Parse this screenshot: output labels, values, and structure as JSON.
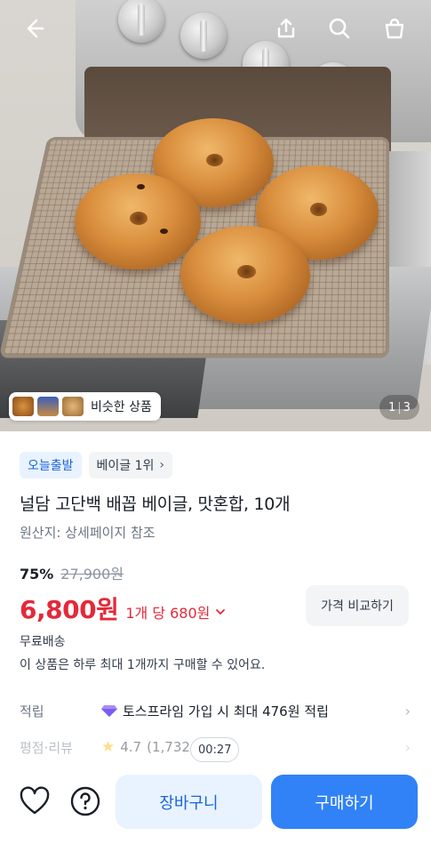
{
  "gallery": {
    "similar_label": "비슷한 상품",
    "current_page": "1",
    "total_pages": "3",
    "separator": "|"
  },
  "badges": {
    "today_delivery": "오늘출발",
    "ranking": "베이글 1위"
  },
  "product": {
    "title": "널담 고단백 배꼽 베이글, 맛혼합, 10개",
    "origin": "원산지: 상세페이지 참조"
  },
  "pricing": {
    "discount": "75%",
    "original_price": "27,900원",
    "price": "6,800원",
    "unit_price": "1개 당 680원",
    "compare_label": "가격 비교하기"
  },
  "shipping": {
    "free_shipping": "무료배송",
    "purchase_limit": "이 상품은 하루 최대 1개까지 구매할 수 있어요."
  },
  "points": {
    "label": "적립",
    "value": "토스프라임 가입 시 최대 476원 적립"
  },
  "reviews": {
    "label": "평점·리뷰",
    "rating": "4.7",
    "count": "(1,732",
    "timer": "00:27"
  },
  "actions": {
    "cart": "장바구니",
    "buy": "구매하기"
  },
  "colors": {
    "accent_blue": "#3182f6",
    "price_red": "#e42939"
  },
  "icons": [
    "back-arrow-icon",
    "share-icon",
    "search-icon",
    "shopping-bag-icon",
    "heart-icon",
    "question-icon",
    "chevron-right-icon",
    "chevron-down-icon",
    "gem-icon",
    "star-icon"
  ]
}
